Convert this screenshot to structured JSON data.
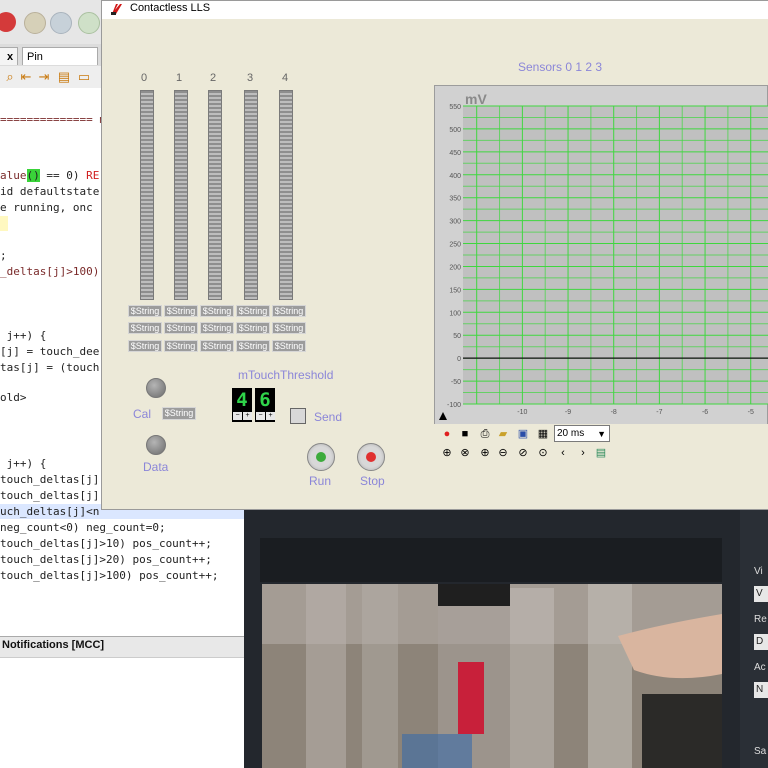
{
  "ide": {
    "tabs": [
      {
        "label": "Pin Module"
      }
    ],
    "code_lines": [
      {
        "y": 112,
        "text": "============== ma"
      },
      {
        "y": 176,
        "text": "alue() == 0) RE"
      },
      {
        "y": 192,
        "text": "id defaultstate"
      },
      {
        "y": 208,
        "text": "e running, onc"
      },
      {
        "y": 224,
        "text": ""
      },
      {
        "y": 256,
        "text": ";"
      },
      {
        "y": 272,
        "text": "_deltas[j]>100)"
      },
      {
        "y": 336,
        "text": " j++) {"
      },
      {
        "y": 352,
        "text": "[j] = touch_dee"
      },
      {
        "y": 368,
        "text": "tas[j] = (touch"
      },
      {
        "y": 398,
        "text": "old>"
      },
      {
        "y": 464,
        "text": " j++) {"
      },
      {
        "y": 480,
        "text": "touch_deltas[j]"
      },
      {
        "y": 496,
        "text": "touch_deltas[j]"
      },
      {
        "y": 512,
        "text": "uch_deltas[j]<n"
      },
      {
        "y": 528,
        "text": "neg_count<0) neg_count=0;"
      },
      {
        "y": 544,
        "text": "touch_deltas[j]>10) pos_count++;"
      },
      {
        "y": 560,
        "text": "touch_deltas[j]>20) pos_count++;"
      },
      {
        "y": 576,
        "text": "touch_deltas[j]>100) pos_count++;"
      }
    ],
    "notifications_label": "Notifications [MCC]"
  },
  "window": {
    "title": "Contactless LLS",
    "columns": [
      "0",
      "1",
      "2",
      "3",
      "4"
    ],
    "string_placeholder": "$String",
    "cal_label": "Cal",
    "cal_value": "$String",
    "data_label": "Data",
    "threshold_label": "mTouchThreshold",
    "threshold_digits": [
      "4",
      "6"
    ],
    "send_label": "Send",
    "run_label": "Run",
    "stop_label": "Stop",
    "zoom_value": "20 ms"
  },
  "player": {
    "side_labels": [
      "Vi",
      "Re",
      "Ac",
      "Sa"
    ],
    "side_boxes": [
      "V",
      "D",
      "N"
    ]
  },
  "chart_data": {
    "type": "line",
    "title": "Sensors  0 1 2 3",
    "ylabel": "mV",
    "xlabel": "",
    "ylim": [
      -100,
      550
    ],
    "xlim": [
      -11.3,
      -4.6
    ],
    "y_ticks": [
      550,
      500,
      450,
      400,
      350,
      300,
      250,
      200,
      150,
      100,
      50,
      0,
      -50,
      -100
    ],
    "x_ticks": [
      -10,
      -9,
      -8,
      -7,
      -6,
      -5
    ],
    "grid": true,
    "series": [
      {
        "x": [
          -11.3,
          -4.6
        ],
        "y": [
          0,
          0
        ]
      }
    ]
  },
  "colors": {
    "accent_label": "#8b86d8",
    "grid": "#3fd73f",
    "plot_bg": "#c0c0c0",
    "run_dot": "#3cab3c",
    "stop_dot": "#e03030"
  }
}
